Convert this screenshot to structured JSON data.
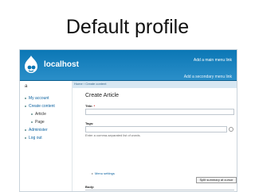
{
  "slide": {
    "title": "Default profile"
  },
  "site": {
    "name": "localhost",
    "main_link": "Add a main menu link",
    "secondary_link": "Add a secondary menu link"
  },
  "sidebar": {
    "block_title": "a",
    "items": [
      {
        "label": "My account"
      },
      {
        "label": "Create content"
      },
      {
        "label": "Article"
      },
      {
        "label": "Page"
      },
      {
        "label": "Administer"
      },
      {
        "label": "Log out"
      }
    ]
  },
  "content": {
    "breadcrumb": "Home › Create content",
    "title": "Create Article",
    "title_label": "Title:",
    "required_marker": "*",
    "tags_label": "Tags:",
    "tags_help": "Enter a comma-separated list of words.",
    "menu_settings": "Menu settings",
    "split_button": "Split summary at cursor",
    "body_label": "Body:"
  }
}
